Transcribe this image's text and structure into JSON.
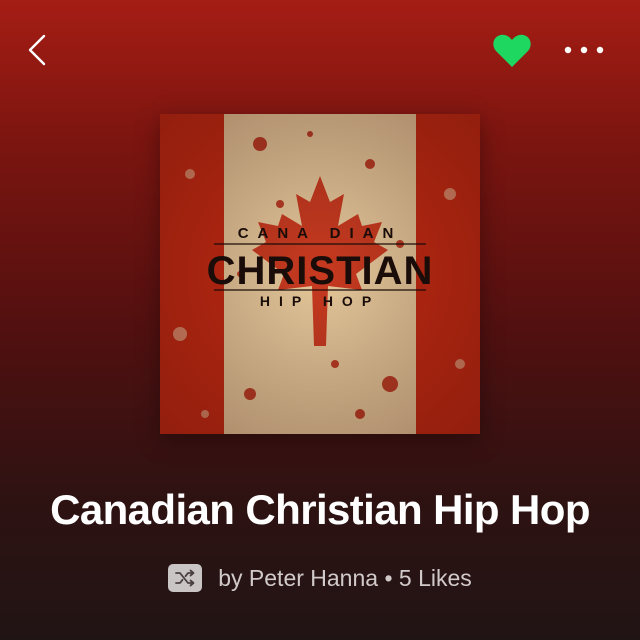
{
  "header": {
    "back_icon": "chevron-left-icon",
    "like_icon": "heart-icon",
    "like_color": "#1ed760",
    "more_icon": "more-dots-icon"
  },
  "playlist": {
    "cover": {
      "line1": "CANA DIAN",
      "line2": "CHRISTIAN",
      "line3": "HIP HOP"
    },
    "title": "Canadian Christian Hip Hop",
    "shuffle_icon": "shuffle-icon",
    "meta": "by Peter Hanna • 5 Likes"
  },
  "colors": {
    "background_top": "#a51d14",
    "background_bottom": "#211414",
    "meta_text": "#d2caca"
  }
}
